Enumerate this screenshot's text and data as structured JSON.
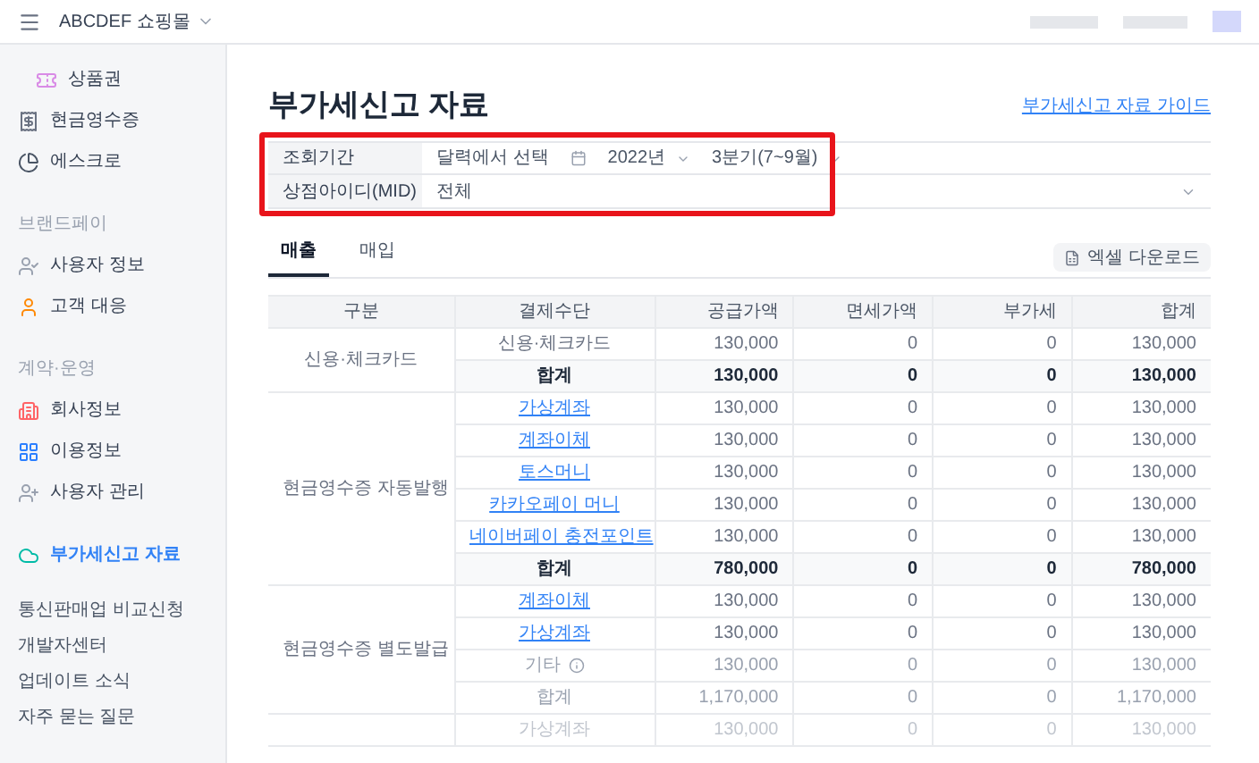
{
  "header": {
    "shop_name": "ABCDEF 쇼핑몰"
  },
  "sidebar": {
    "groups": [
      {
        "items": [
          {
            "label": "상품권",
            "indented": true,
            "selected": false
          },
          {
            "label": "현금영수증",
            "indented": false,
            "selected": false
          },
          {
            "label": "에스크로",
            "indented": false,
            "selected": false
          }
        ]
      },
      {
        "heading": "브랜드페이",
        "items": [
          {
            "label": "사용자 정보",
            "indented": false,
            "selected": false
          },
          {
            "label": "고객 대응",
            "indented": false,
            "selected": false
          }
        ]
      },
      {
        "heading": "계약·운영",
        "items": [
          {
            "label": "회사정보",
            "indented": false,
            "selected": false
          },
          {
            "label": "이용정보",
            "indented": false,
            "selected": false
          },
          {
            "label": "사용자 관리",
            "indented": false,
            "selected": false
          }
        ]
      },
      {
        "items": [
          {
            "label": "부가세신고 자료",
            "indented": false,
            "selected": true
          }
        ]
      }
    ],
    "links": [
      "통신판매업 비교신청",
      "개발자센터",
      "업데이트 소식",
      "자주 묻는 질문"
    ]
  },
  "page": {
    "title": "부가세신고 자료",
    "guide_link": "부가세신고 자료 가이드"
  },
  "filter": {
    "period_label": "조회기간",
    "date_mode": "달력에서 선택",
    "year": "2022년",
    "quarter": "3분기(7~9월)",
    "mid_label": "상점아이디(MID)",
    "mid_value": "전체"
  },
  "tabs": [
    {
      "label": "매출",
      "selected": true
    },
    {
      "label": "매입",
      "selected": false
    }
  ],
  "excel_button": "엑셀 다운로드",
  "table": {
    "columns": [
      "구분",
      "결제수단",
      "공급가액",
      "면세가액",
      "부가세",
      "합계"
    ],
    "groups": [
      {
        "label": "신용·체크카드",
        "rows": [
          {
            "method": "신용·체크카드",
            "kind": "plain",
            "values": [
              "130,000",
              "0",
              "0",
              "130,000"
            ]
          },
          {
            "method": "합계",
            "kind": "total",
            "values": [
              "130,000",
              "0",
              "0",
              "130,000"
            ]
          }
        ]
      },
      {
        "label": "현금영수증 자동발행",
        "rows": [
          {
            "method": "가상계좌",
            "kind": "link",
            "values": [
              "130,000",
              "0",
              "0",
              "130,000"
            ]
          },
          {
            "method": "계좌이체",
            "kind": "link",
            "values": [
              "130,000",
              "0",
              "0",
              "130,000"
            ]
          },
          {
            "method": "토스머니",
            "kind": "link",
            "values": [
              "130,000",
              "0",
              "0",
              "130,000"
            ]
          },
          {
            "method": "카카오페이 머니",
            "kind": "link",
            "values": [
              "130,000",
              "0",
              "0",
              "130,000"
            ]
          },
          {
            "method": "네이버페이 충전포인트",
            "kind": "link",
            "values": [
              "130,000",
              "0",
              "0",
              "130,000"
            ]
          },
          {
            "method": "합계",
            "kind": "total",
            "values": [
              "780,000",
              "0",
              "0",
              "780,000"
            ]
          }
        ]
      },
      {
        "label": "현금영수증 별도발급",
        "rows": [
          {
            "method": "계좌이체",
            "kind": "link",
            "values": [
              "130,000",
              "0",
              "0",
              "130,000"
            ]
          },
          {
            "method": "가상계좌",
            "kind": "link",
            "values": [
              "130,000",
              "0",
              "0",
              "130,000"
            ]
          },
          {
            "method": "기타",
            "kind": "other",
            "values": [
              "130,000",
              "0",
              "0",
              "130,000"
            ]
          },
          {
            "method": "합계",
            "kind": "faded",
            "values": [
              "1,170,000",
              "0",
              "0",
              "1,170,000"
            ]
          }
        ]
      },
      {
        "rows": [
          {
            "method": "가상계좌",
            "kind": "faded",
            "values": [
              "130,000",
              "0",
              "0",
              "130,000"
            ]
          }
        ]
      }
    ]
  }
}
